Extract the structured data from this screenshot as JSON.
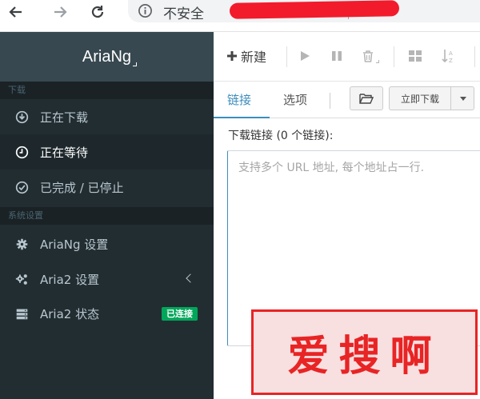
{
  "browser": {
    "security_label": "不安全"
  },
  "sidebar": {
    "brand": "AriaNg",
    "sections": [
      {
        "header": "下载",
        "items": [
          {
            "label": "正在下载",
            "icon": "download-circle-icon"
          },
          {
            "label": "正在等待",
            "icon": "clock-icon"
          },
          {
            "label": "已完成 / 已停止",
            "icon": "check-circle-icon"
          }
        ]
      },
      {
        "header": "系统设置",
        "items": [
          {
            "label": "AriaNg 设置",
            "icon": "gear-icon"
          },
          {
            "label": "Aria2 设置",
            "icon": "gears-icon"
          },
          {
            "label": "Aria2 状态",
            "icon": "server-icon",
            "badge": "已连接"
          }
        ]
      }
    ]
  },
  "toolbar": {
    "new_label": "新建"
  },
  "tabs": [
    {
      "label": "链接"
    },
    {
      "label": "选项"
    }
  ],
  "download": {
    "button_label": "立即下载",
    "links_label": "下载链接 (0 个链接):",
    "placeholder": "支持多个 URL 地址, 每个地址占一行."
  },
  "watermark": {
    "text": "爱搜啊"
  },
  "colors": {
    "sidebar_bg": "#222d32",
    "brand_bg": "#374850",
    "accent": "#3c8dbc",
    "badge_green": "#00a65a",
    "watermark_red": "#e82424"
  }
}
